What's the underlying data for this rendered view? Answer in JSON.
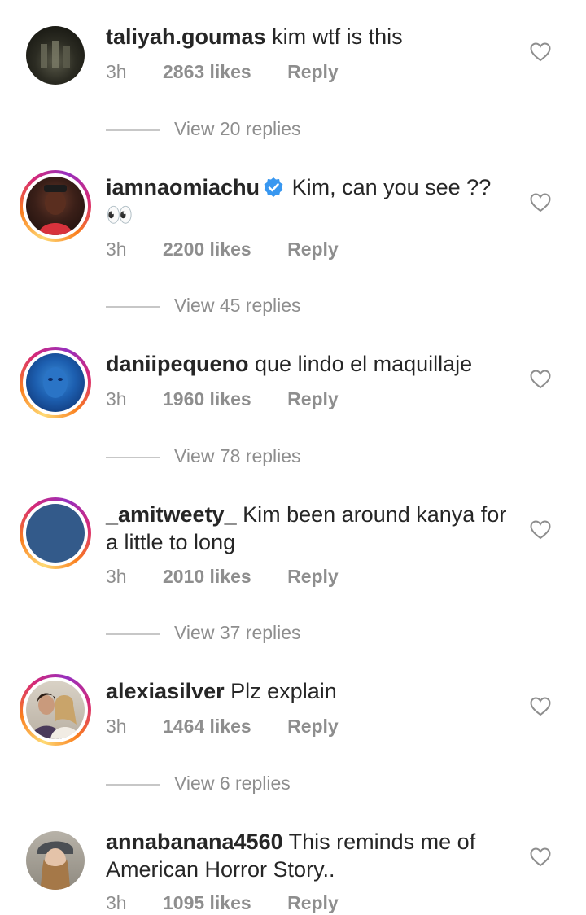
{
  "comments": [
    {
      "username": "taliyah.goumas",
      "text": "kim wtf is this",
      "time": "3h",
      "likes": "2863 likes",
      "reply": "Reply",
      "view_replies": "View 20 replies",
      "verified": false,
      "story_ring": false
    },
    {
      "username": "iamnaomiachu",
      "text": "Kim, can you see ?? 👀",
      "time": "3h",
      "likes": "2200 likes",
      "reply": "Reply",
      "view_replies": "View 45 replies",
      "verified": true,
      "story_ring": true
    },
    {
      "username": "daniipequeno",
      "text": "que lindo el maquillaje",
      "time": "3h",
      "likes": "1960 likes",
      "reply": "Reply",
      "view_replies": "View 78 replies",
      "verified": false,
      "story_ring": true
    },
    {
      "username": "_amitweety_",
      "text": "Kim been around kanya for a little to long",
      "time": "3h",
      "likes": "2010 likes",
      "reply": "Reply",
      "view_replies": "View 37 replies",
      "verified": false,
      "story_ring": true
    },
    {
      "username": "alexiasilver",
      "text": "Plz explain",
      "time": "3h",
      "likes": "1464 likes",
      "reply": "Reply",
      "view_replies": "View 6 replies",
      "verified": false,
      "story_ring": true
    },
    {
      "username": "annabanana4560",
      "text": "This reminds me of American Horror Story..",
      "time": "3h",
      "likes": "1095 likes",
      "reply": "Reply",
      "verified": false,
      "story_ring": false
    }
  ],
  "icons": {
    "like": "heart-outline-icon",
    "verified": "verified-badge-icon"
  },
  "colors": {
    "verified_blue": "#3897f0",
    "meta_gray": "#8e8e8e",
    "text": "#262626"
  }
}
